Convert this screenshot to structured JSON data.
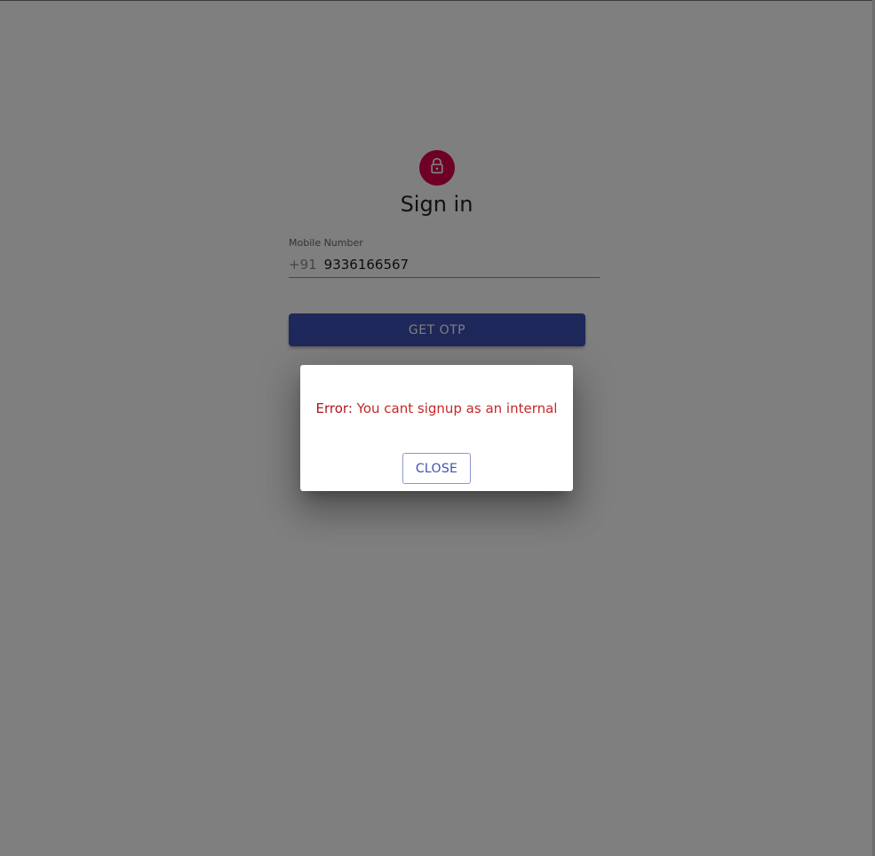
{
  "signin": {
    "title": "Sign in",
    "icon": "lock-icon",
    "avatar_color": "#dc004e",
    "mobile_label": "Mobile Number",
    "country_code": "+91",
    "mobile_value": "9336166567",
    "get_otp_label": "GET OTP",
    "button_color": "#3f51b5"
  },
  "dialog": {
    "error_prefix": "Error:",
    "error_message": "You cant signup as an internal",
    "close_label": "CLOSE",
    "error_color": "#c62828"
  }
}
